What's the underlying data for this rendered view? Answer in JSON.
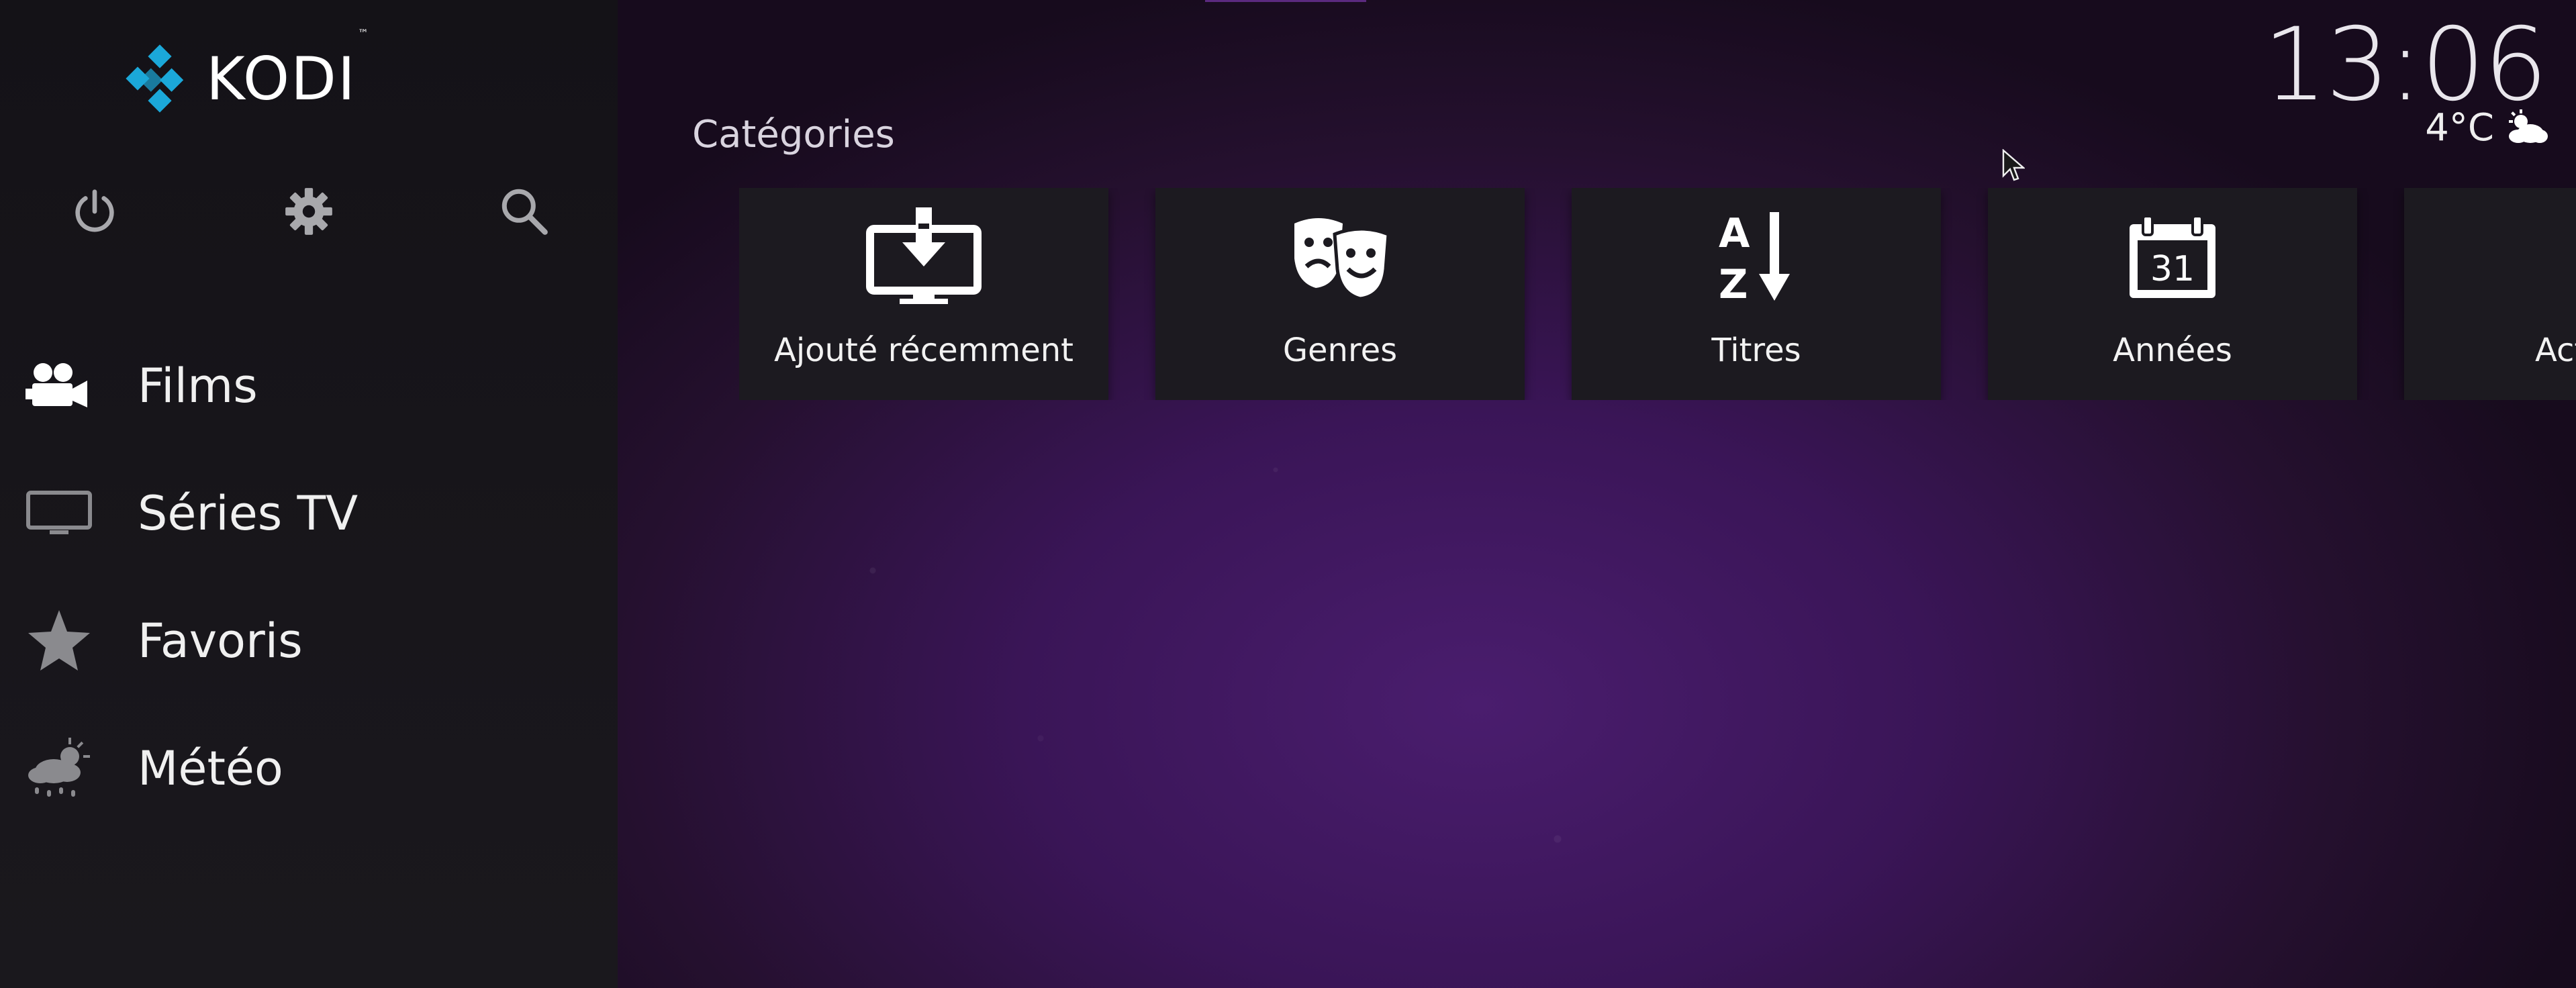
{
  "app": {
    "name": "KODI",
    "trademark": "™"
  },
  "top_icons": [
    "power-icon",
    "settings-icon",
    "search-icon"
  ],
  "menu": {
    "items": [
      {
        "label": "Films",
        "icon": "movie-camera-icon"
      },
      {
        "label": "Séries TV",
        "icon": "tv-icon"
      },
      {
        "label": "Favoris",
        "icon": "star-icon"
      },
      {
        "label": "Météo",
        "icon": "weather-icon"
      }
    ]
  },
  "header": {
    "section_title": "Catégories",
    "clock": "13:06",
    "temperature": "4°C",
    "weather_icon": "partly-cloudy-icon"
  },
  "categories": [
    {
      "label": "Ajouté récemment",
      "icon": "recently-added-icon"
    },
    {
      "label": "Genres",
      "icon": "theater-masks-icon"
    },
    {
      "label": "Titres",
      "icon": "sort-az-icon"
    },
    {
      "label": "Années",
      "icon": "calendar-icon",
      "icon_text": "31"
    },
    {
      "label": "Act",
      "icon": "mask-icon"
    }
  ],
  "colors": {
    "logo_blue": "#1ba8d9",
    "background_purple": "#4a1d6e",
    "sidebar": "#18161b",
    "tile": "#1c1a20"
  }
}
